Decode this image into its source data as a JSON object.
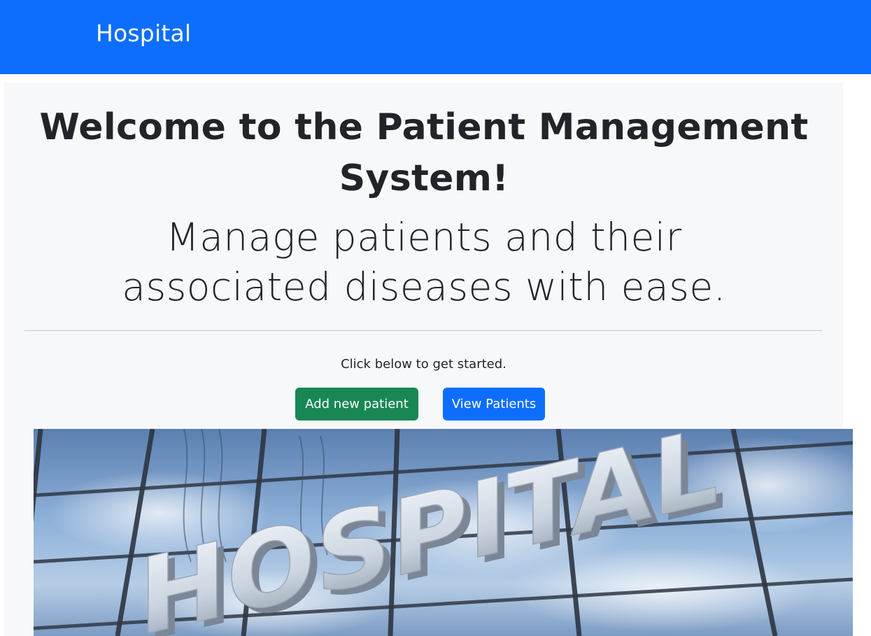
{
  "navbar": {
    "brand": "Hospital",
    "color": "#0d6efd"
  },
  "jumbotron": {
    "title": "Welcome to the Patient Management System!",
    "lead": "Manage patients and their associated diseases with ease.",
    "hint": "Click below to get started.",
    "background": "#f7f8fa"
  },
  "actions": {
    "add_label": "Add new patient",
    "add_color": "#198754",
    "view_label": "View Patients",
    "view_color": "#0d6efd"
  },
  "hero_image": {
    "sign_text": "HOSPITAL"
  }
}
